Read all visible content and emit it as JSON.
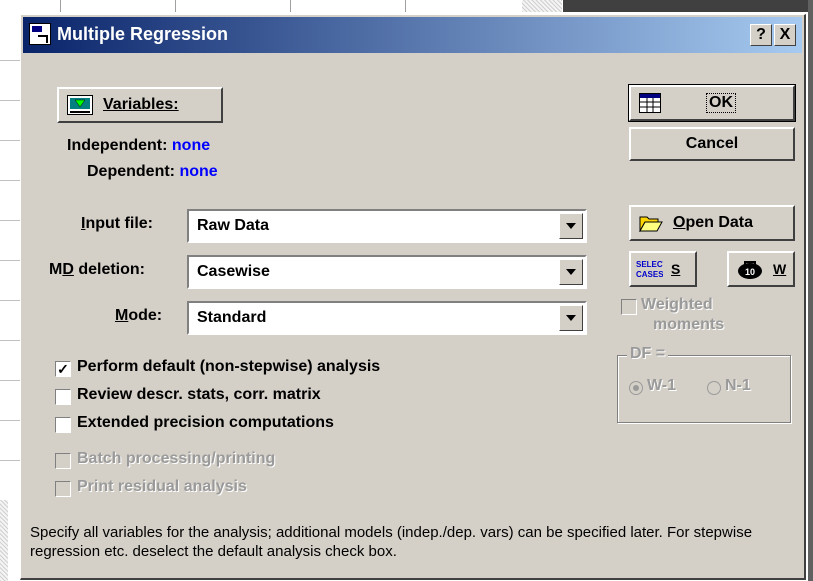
{
  "window": {
    "title": "Multiple Regression"
  },
  "titlebar_buttons": {
    "help": "?",
    "close": "X"
  },
  "variables": {
    "button_label": "Variables:",
    "independent_label": "Independent:",
    "independent_value": "none",
    "dependent_label": "Dependent:",
    "dependent_value": "none"
  },
  "buttons": {
    "ok": "OK",
    "cancel": "Cancel",
    "open_data": "Open Data",
    "select_cases_icon_text": "SELECT CASES",
    "select_cases_letter": "S",
    "weight_letter": "W"
  },
  "fields": {
    "input_file": {
      "label": "Input file:",
      "value": "Raw Data"
    },
    "md_deletion": {
      "label": "MD deletion:",
      "value": "Casewise"
    },
    "mode": {
      "label": "Mode:",
      "value": "Standard"
    }
  },
  "options": [
    {
      "label": "Perform default (non-stepwise) analysis",
      "checked": true,
      "enabled": true
    },
    {
      "label": "Review descr. stats, corr. matrix",
      "checked": false,
      "enabled": true
    },
    {
      "label": "Extended precision computations",
      "checked": false,
      "enabled": true
    },
    {
      "label": "Batch processing/printing",
      "checked": false,
      "enabled": false
    },
    {
      "label": "Print residual analysis",
      "checked": false,
      "enabled": false
    }
  ],
  "weighted": {
    "line1": "Weighted",
    "line2": "moments"
  },
  "df": {
    "title": "DF =",
    "option1": "W-1",
    "option2": "N-1",
    "selected": "W-1"
  },
  "hint": "Specify all variables for the analysis; additional models (indep./dep. vars) can be specified later.  For stepwise regression etc. deselect the default analysis check box."
}
